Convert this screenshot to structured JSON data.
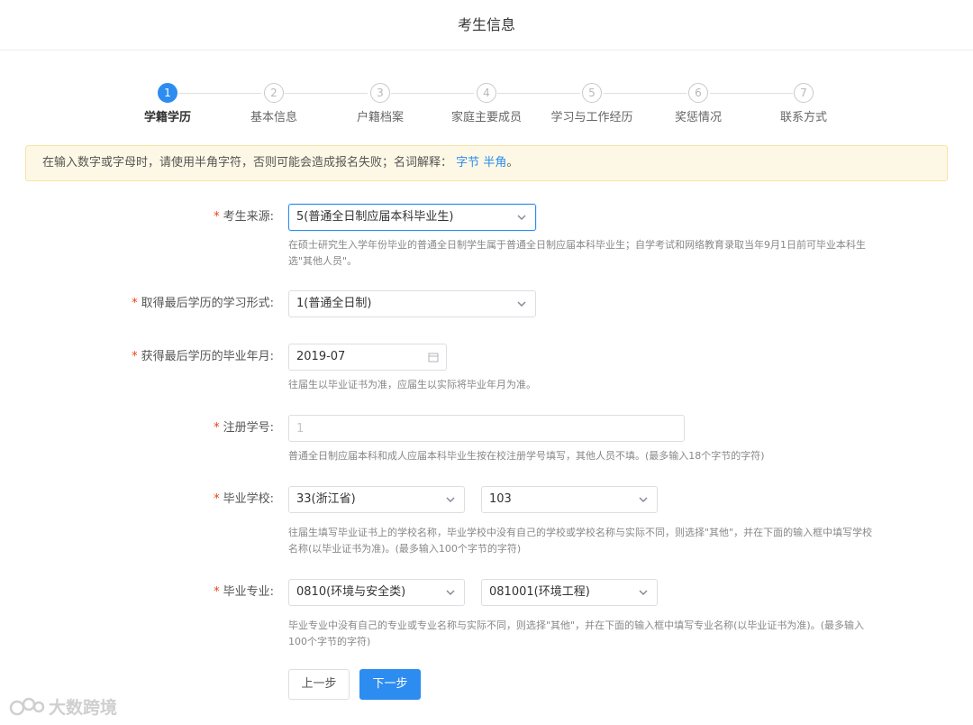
{
  "header": {
    "title": "考生信息"
  },
  "steps": [
    {
      "num": "1",
      "label": "学籍学历",
      "active": true
    },
    {
      "num": "2",
      "label": "基本信息",
      "active": false
    },
    {
      "num": "3",
      "label": "户籍档案",
      "active": false
    },
    {
      "num": "4",
      "label": "家庭主要成员",
      "active": false
    },
    {
      "num": "5",
      "label": "学习与工作经历",
      "active": false
    },
    {
      "num": "6",
      "label": "奖惩情况",
      "active": false
    },
    {
      "num": "7",
      "label": "联系方式",
      "active": false
    }
  ],
  "notice": {
    "text": "在输入数字或字母时，请使用半角字符，否则可能会造成报名失败；名词解释：",
    "link1": "字节",
    "link2": "半角",
    "end": "。"
  },
  "form": {
    "source": {
      "required": "*",
      "label": "考生来源:",
      "value": "5(普通全日制应届本科毕业生)",
      "help": "在硕士研究生入学年份毕业的普通全日制学生属于普通全日制应届本科毕业生；自学考试和网络教育录取当年9月1日前可毕业本科生选\"其他人员\"。"
    },
    "study_form": {
      "required": "*",
      "label": "取得最后学历的学习形式:",
      "value": "1(普通全日制)"
    },
    "grad_date": {
      "required": "*",
      "label": "获得最后学历的毕业年月:",
      "value": "2019-07",
      "help": "往届生以毕业证书为准，应届生以实际将毕业年月为准。"
    },
    "reg_number": {
      "required": "*",
      "label": "注册学号:",
      "value": "1",
      "help": "普通全日制应届本科和成人应届本科毕业生按在校注册学号填写，其他人员不填。(最多输入18个字节的字符)"
    },
    "school": {
      "required": "*",
      "label": "毕业学校:",
      "province": "33(浙江省)",
      "school": "103",
      "help": "往届生填写毕业证书上的学校名称，毕业学校中没有自己的学校或学校名称与实际不同，则选择\"其他\"，并在下面的输入框中填写学校名称(以毕业证书为准)。(最多输入100个字节的字符)"
    },
    "major": {
      "required": "*",
      "label": "毕业专业:",
      "category": "0810(环境与安全类)",
      "major": "081001(环境工程)",
      "help": "毕业专业中没有自己的专业或专业名称与实际不同，则选择\"其他\"，并在下面的输入框中填写专业名称(以毕业证书为准)。(最多输入100个字节的字符)"
    }
  },
  "buttons": {
    "prev": "上一步",
    "next": "下一步"
  },
  "watermark": {
    "text": "大数跨境"
  },
  "colors": {
    "primary": "#2d8cf0",
    "required": "#ed4014",
    "notice_bg": "#fdf8e5"
  }
}
